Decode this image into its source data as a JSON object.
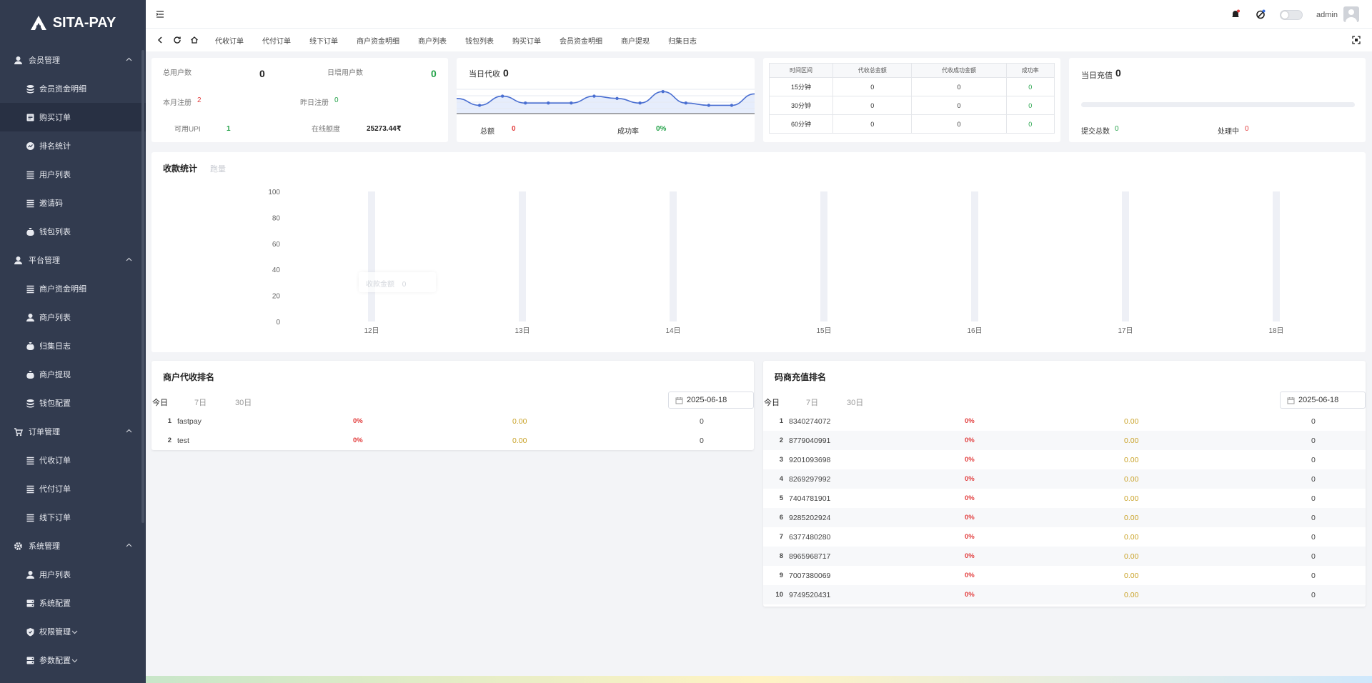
{
  "brand": {
    "name": "SITA-PAY"
  },
  "sidebar": {
    "groups": [
      {
        "label": "会员管理",
        "icon": "user-icon",
        "items": [
          {
            "label": "会员资金明细",
            "icon": "database-icon"
          },
          {
            "label": "购买订单",
            "icon": "ledger-icon",
            "active": true
          },
          {
            "label": "排名统计",
            "icon": "ranking-icon"
          },
          {
            "label": "用户列表",
            "icon": "list-icon"
          },
          {
            "label": "邀请码",
            "icon": "list-icon"
          },
          {
            "label": "钱包列表",
            "icon": "money-bag-icon"
          }
        ]
      },
      {
        "label": "平台管理",
        "icon": "user-icon",
        "items": [
          {
            "label": "商户资金明细",
            "icon": "list-icon"
          },
          {
            "label": "商户列表",
            "icon": "user-icon"
          },
          {
            "label": "归集日志",
            "icon": "money-bag-icon"
          },
          {
            "label": "商户提现",
            "icon": "money-bag-icon"
          },
          {
            "label": "钱包配置",
            "icon": "database-icon"
          }
        ]
      },
      {
        "label": "订单管理",
        "icon": "cart-icon",
        "items": [
          {
            "label": "代收订单",
            "icon": "list-icon"
          },
          {
            "label": "代付订单",
            "icon": "list-icon"
          },
          {
            "label": "线下订单",
            "icon": "list-icon"
          }
        ]
      },
      {
        "label": "系统管理",
        "icon": "gear-icon",
        "items": [
          {
            "label": "用户列表",
            "icon": "user-icon"
          },
          {
            "label": "系统配置",
            "icon": "server-icon"
          },
          {
            "label": "权限管理",
            "icon": "shield-icon",
            "expandable": true
          },
          {
            "label": "参数配置",
            "icon": "server-icon",
            "expandable": true
          }
        ]
      }
    ]
  },
  "header": {
    "user": "admin"
  },
  "tabs": [
    "代收订单",
    "代付订单",
    "线下订单",
    "商户资金明细",
    "商户列表",
    "钱包列表",
    "购买订单",
    "会员资金明细",
    "商户提现",
    "归集日志"
  ],
  "stats": {
    "total_users_label": "总用户数",
    "total_users": "0",
    "daily_new_label": "日增用户数",
    "daily_new": "0",
    "month_reg_label": "本月注册",
    "month_reg": "2",
    "yesterday_reg_label": "昨日注册",
    "yesterday_reg": "0",
    "upi_label": "可用UPI",
    "upi": "1",
    "online_label": "在线额度",
    "online": "25273.44₹"
  },
  "today_collect": {
    "title": "当日代收",
    "value": "0",
    "total_label": "总额",
    "total": "0",
    "rate_label": "成功率",
    "rate": "0%"
  },
  "interval_table": {
    "headers": [
      "时间区间",
      "代收总金额",
      "代收成功金额",
      "成功率"
    ],
    "rows": [
      [
        "15分钟",
        "0",
        "0",
        "0"
      ],
      [
        "30分钟",
        "0",
        "0",
        "0"
      ],
      [
        "60分钟",
        "0",
        "0",
        "0"
      ]
    ]
  },
  "today_recharge": {
    "title": "当日充值",
    "value": "0",
    "submit_label": "提交总数",
    "submit": "0",
    "processing_label": "处理中",
    "processing": "0"
  },
  "collection_stats": {
    "title": "收款统计",
    "tab2": "跑量",
    "tooltip_label": "收款金额",
    "tooltip_value": "0"
  },
  "chart_data": {
    "type": "bar",
    "categories": [
      "12日",
      "13日",
      "14日",
      "15日",
      "16日",
      "17日",
      "18日"
    ],
    "values": [
      0,
      0,
      0,
      0,
      0,
      0,
      0
    ],
    "ylim": [
      0,
      100
    ],
    "yticks": [
      100,
      80,
      60,
      40,
      20,
      0
    ],
    "series": [
      {
        "name": "收款金额",
        "values": [
          0,
          0,
          0,
          0,
          0,
          0,
          0
        ]
      }
    ]
  },
  "sparkline": {
    "values": [
      6,
      3,
      7,
      4,
      4,
      4,
      7,
      6,
      4,
      9,
      4,
      3,
      3,
      8
    ]
  },
  "merchant_rank": {
    "title": "商户代收排名",
    "filters": [
      "今日",
      "7日",
      "30日"
    ],
    "date": "2025-06-18",
    "rows": [
      {
        "rank": "1",
        "name": "fastpay",
        "pct": "0%",
        "amount": "0.00",
        "count": "0"
      },
      {
        "rank": "2",
        "name": "test",
        "pct": "0%",
        "amount": "0.00",
        "count": "0"
      }
    ]
  },
  "code_rank": {
    "title": "码商充值排名",
    "filters": [
      "今日",
      "7日",
      "30日"
    ],
    "date": "2025-06-18",
    "rows": [
      {
        "rank": "1",
        "name": "8340274072",
        "pct": "0%",
        "amount": "0.00",
        "count": "0"
      },
      {
        "rank": "2",
        "name": "8779040991",
        "pct": "0%",
        "amount": "0.00",
        "count": "0"
      },
      {
        "rank": "3",
        "name": "9201093698",
        "pct": "0%",
        "amount": "0.00",
        "count": "0"
      },
      {
        "rank": "4",
        "name": "8269297992",
        "pct": "0%",
        "amount": "0.00",
        "count": "0"
      },
      {
        "rank": "5",
        "name": "7404781901",
        "pct": "0%",
        "amount": "0.00",
        "count": "0"
      },
      {
        "rank": "6",
        "name": "9285202924",
        "pct": "0%",
        "amount": "0.00",
        "count": "0"
      },
      {
        "rank": "7",
        "name": "6377480280",
        "pct": "0%",
        "amount": "0.00",
        "count": "0"
      },
      {
        "rank": "8",
        "name": "8965968717",
        "pct": "0%",
        "amount": "0.00",
        "count": "0"
      },
      {
        "rank": "9",
        "name": "7007380069",
        "pct": "0%",
        "amount": "0.00",
        "count": "0"
      },
      {
        "rank": "10",
        "name": "9749520431",
        "pct": "0%",
        "amount": "0.00",
        "count": "0"
      }
    ]
  },
  "colors": {
    "sidebar": "#323b4f",
    "accent": "#4a6fd1",
    "red": "#e23c3c",
    "green": "#25a34a",
    "gold": "#c9a227"
  }
}
